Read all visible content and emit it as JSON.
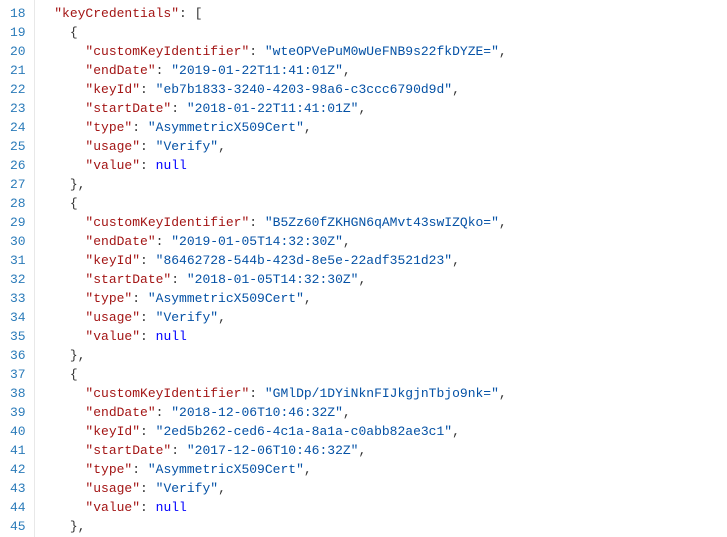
{
  "startLine": 18,
  "endLine": 45,
  "rootKey": "keyCredentials",
  "entries": [
    {
      "customKeyIdentifier": "wteOPVePuM0wUeFNB9s22fkDYZE=",
      "endDate": "2019-01-22T11:41:01Z",
      "keyId": "eb7b1833-3240-4203-98a6-c3ccc6790d9d",
      "startDate": "2018-01-22T11:41:01Z",
      "type": "AsymmetricX509Cert",
      "usage": "Verify",
      "value": null
    },
    {
      "customKeyIdentifier": "B5Zz60fZKHGN6qAMvt43swIZQko=",
      "endDate": "2019-01-05T14:32:30Z",
      "keyId": "86462728-544b-423d-8e5e-22adf3521d23",
      "startDate": "2018-01-05T14:32:30Z",
      "type": "AsymmetricX509Cert",
      "usage": "Verify",
      "value": null
    },
    {
      "customKeyIdentifier": "GMlDp/1DYiNknFIJkgjnTbjo9nk=",
      "endDate": "2018-12-06T10:46:32Z",
      "keyId": "2ed5b262-ced6-4c1a-8a1a-c0abb82ae3c1",
      "startDate": "2017-12-06T10:46:32Z",
      "type": "AsymmetricX509Cert",
      "usage": "Verify",
      "value": null
    }
  ],
  "chart_data": {
    "type": "table",
    "title": "keyCredentials JSON snippet",
    "columns": [
      "customKeyIdentifier",
      "endDate",
      "keyId",
      "startDate",
      "type",
      "usage",
      "value"
    ],
    "rows": [
      [
        "wteOPVePuM0wUeFNB9s22fkDYZE=",
        "2019-01-22T11:41:01Z",
        "eb7b1833-3240-4203-98a6-c3ccc6790d9d",
        "2018-01-22T11:41:01Z",
        "AsymmetricX509Cert",
        "Verify",
        null
      ],
      [
        "B5Zz60fZKHGN6qAMvt43swIZQko=",
        "2019-01-05T14:32:30Z",
        "86462728-544b-423d-8e5e-22adf3521d23",
        "2018-01-05T14:32:30Z",
        "AsymmetricX509Cert",
        "Verify",
        null
      ],
      [
        "GMlDp/1DYiNknFIJkgjnTbjo9nk=",
        "2018-12-06T10:46:32Z",
        "2ed5b262-ced6-4c1a-8a1a-c0abb82ae3c1",
        "2017-12-06T10:46:32Z",
        "AsymmetricX509Cert",
        "Verify",
        null
      ]
    ]
  }
}
